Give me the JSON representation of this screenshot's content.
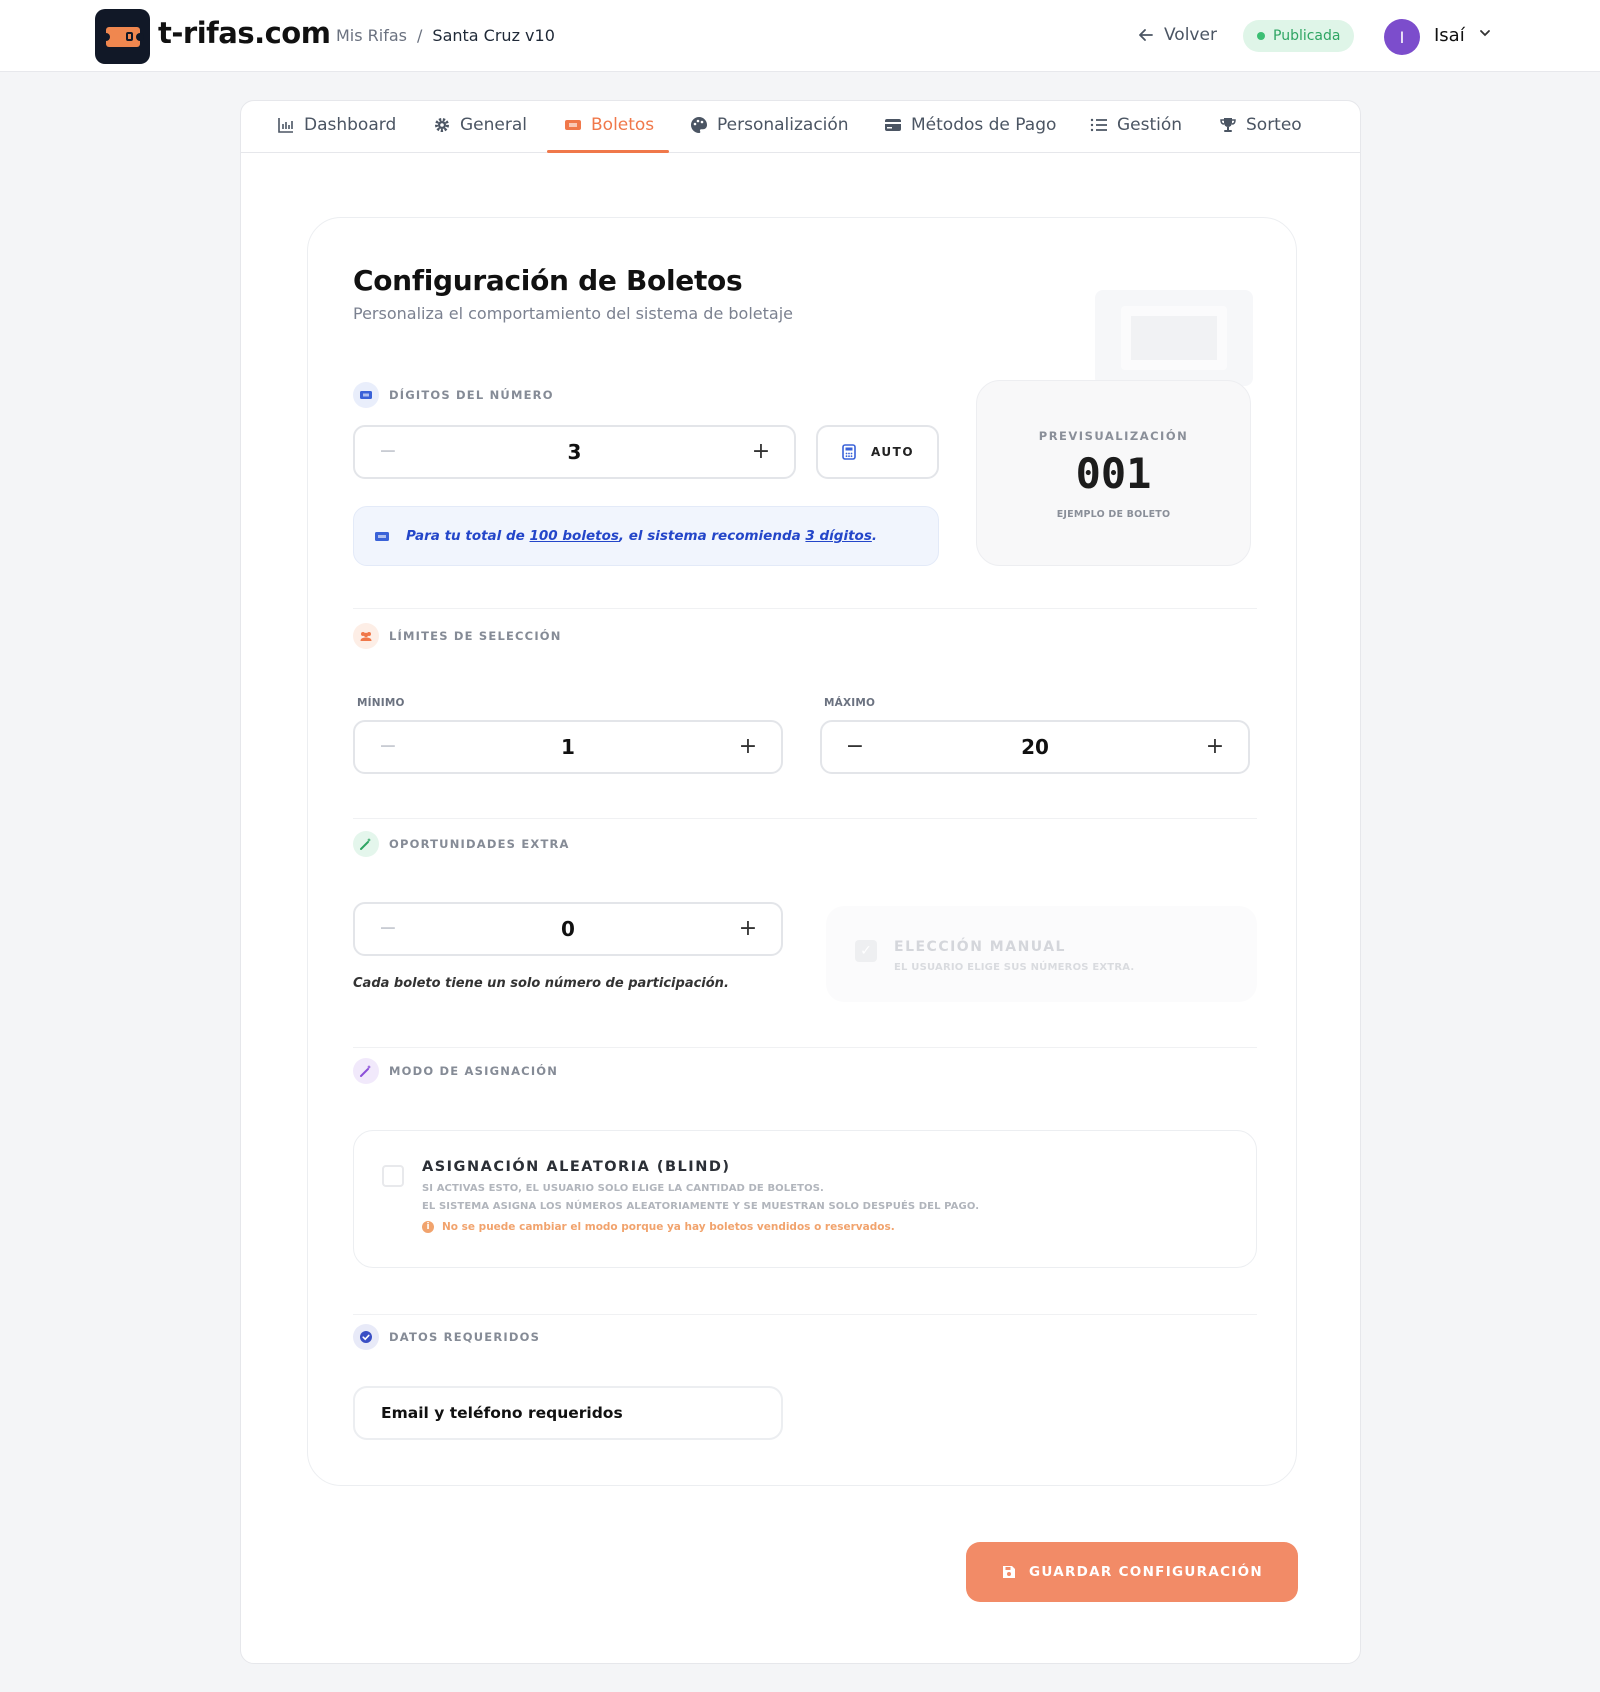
{
  "header": {
    "brand": "t-rifas.com",
    "breadcrumb_root": "Mis Rifas",
    "breadcrumb_sep": "/",
    "breadcrumb_current": "Santa Cruz v10",
    "back_label": "Volver",
    "status_badge": "Publicada",
    "avatar_initial": "I",
    "user_name": "Isaí"
  },
  "tabs": [
    {
      "label": "Dashboard",
      "icon": "chart-icon"
    },
    {
      "label": "General",
      "icon": "gear-icon"
    },
    {
      "label": "Boletos",
      "icon": "ticket-icon",
      "active": true
    },
    {
      "label": "Personalización",
      "icon": "palette-icon"
    },
    {
      "label": "Métodos de Pago",
      "icon": "card-icon"
    },
    {
      "label": "Gestión",
      "icon": "list-icon"
    },
    {
      "label": "Sorteo",
      "icon": "trophy-icon"
    }
  ],
  "card": {
    "title": "Configuración de Boletos",
    "subtitle": "Personaliza el comportamiento del sistema de boletaje"
  },
  "digits": {
    "heading": "DÍGITOS DEL NÚMERO",
    "value": "3",
    "auto_label": "AUTO",
    "hint_prefix": "Para tu total de ",
    "hint_total": "100 boletos",
    "hint_mid": ", el sistema recomienda ",
    "hint_digits": "3 dígitos",
    "hint_suffix": "."
  },
  "preview": {
    "label": "PREVISUALIZACIÓN",
    "number": "001",
    "caption": "EJEMPLO DE BOLETO"
  },
  "limits": {
    "heading": "LÍMITES DE SELECCIÓN",
    "min_label": "MÍNIMO",
    "min_value": "1",
    "max_label": "MÁXIMO",
    "max_value": "20"
  },
  "extra": {
    "heading": "OPORTUNIDADES EXTRA",
    "value": "0",
    "note": "Cada boleto tiene un solo número de participación.",
    "manual_title": "ELECCIÓN MANUAL",
    "manual_desc": "EL USUARIO ELIGE SUS NÚMEROS EXTRA."
  },
  "assignment": {
    "heading": "MODO DE ASIGNACIÓN",
    "title": "ASIGNACIÓN ALEATORIA (BLIND)",
    "desc1": "SI ACTIVAS ESTO, EL USUARIO SOLO ELIGE LA CANTIDAD DE BOLETOS.",
    "desc2": "EL SISTEMA ASIGNA LOS NÚMEROS ALEATORIAMENTE Y SE MUESTRAN SOLO DESPUÉS DEL PAGO.",
    "warning": "No se puede cambiar el modo porque ya hay boletos vendidos o reservados."
  },
  "required": {
    "heading": "DATOS REQUERIDOS",
    "value": "Email y teléfono requeridos"
  },
  "save_label": "GUARDAR CONFIGURACIÓN",
  "colors": {
    "accent": "#f0784a",
    "save_button": "#f28b67",
    "hint_text": "#2446c9",
    "status_green": "#2fa563",
    "avatar": "#7c4dcc"
  }
}
